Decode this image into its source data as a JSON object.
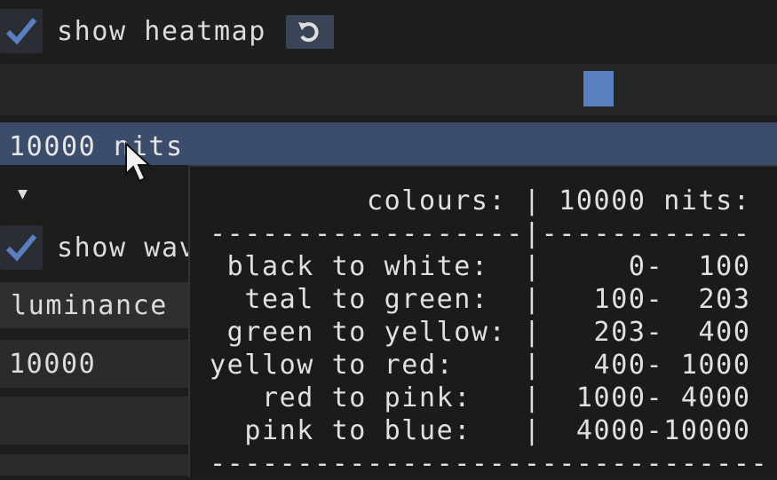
{
  "heatmap": {
    "label": "show heatmap",
    "checked": true,
    "reset_icon": "reset-icon"
  },
  "slider": {
    "value_fraction": 0.77
  },
  "selected_item": {
    "label": "10000 nits"
  },
  "collapse_arrow": "triangle-down-icon",
  "waveform": {
    "label": "show wav",
    "checked": true
  },
  "mode_combo": {
    "value": "luminance"
  },
  "nits_input": {
    "value": "10000"
  },
  "tooltip": {
    "lines": [
      "         colours: | 10000 nits:",
      "------------------|------------",
      " black to white:  |     0-  100",
      "  teal to green:  |   100-  203",
      " green to yellow: |   203-  400",
      "yellow to red:    |   400- 1000",
      "   red to pink:   |  1000- 4000",
      "  pink to blue:   |  4000-10000",
      "--------------------------------"
    ]
  },
  "colors": {
    "accent": "#5a7fc0",
    "highlight": "#3b4d6b"
  }
}
